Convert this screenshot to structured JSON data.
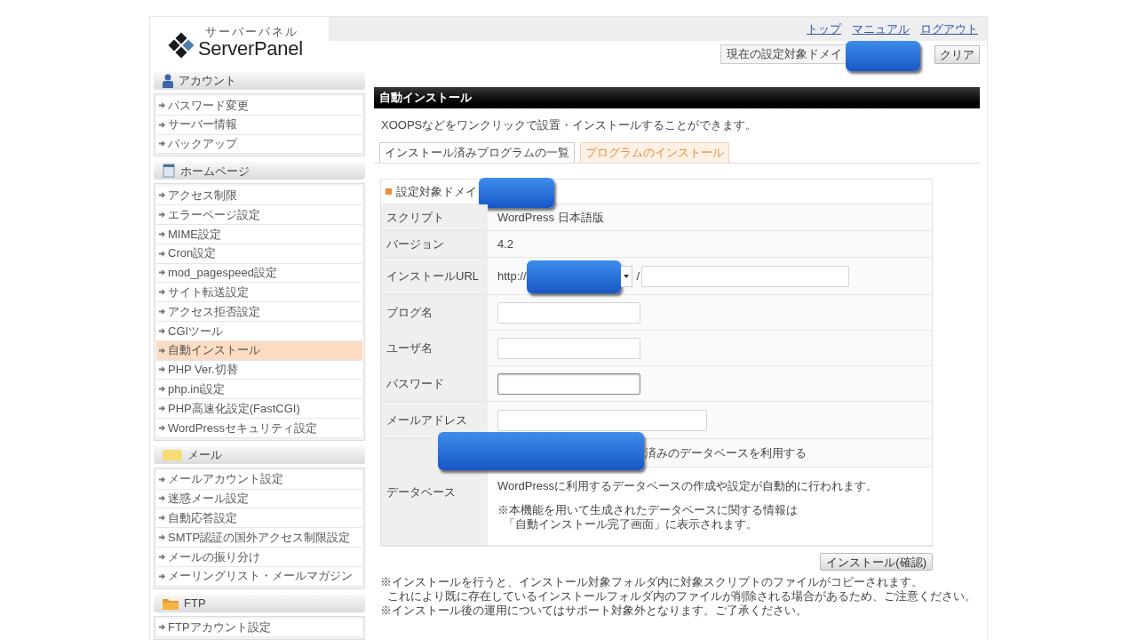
{
  "header": {
    "logo": {
      "kana": "サーバーパネル",
      "name": "ServerPanel"
    },
    "links": [
      "トップ",
      "マニュアル",
      "ログアウト"
    ],
    "domain_label": "現在の設定対象ドメイ",
    "clear_button": "クリア"
  },
  "sidebar": [
    {
      "kind": "account",
      "title": "アカウント",
      "items": [
        {
          "label": "パスワード変更",
          "selected": false
        },
        {
          "label": "サーバー情報",
          "selected": false
        },
        {
          "label": "バックアップ",
          "selected": false
        }
      ]
    },
    {
      "kind": "homepage",
      "title": "ホームページ",
      "items": [
        {
          "label": "アクセス制限",
          "selected": false
        },
        {
          "label": "エラーページ設定",
          "selected": false
        },
        {
          "label": "MIME設定",
          "selected": false
        },
        {
          "label": "Cron設定",
          "selected": false
        },
        {
          "label": "mod_pagespeed設定",
          "selected": false
        },
        {
          "label": "サイト転送設定",
          "selected": false
        },
        {
          "label": "アクセス拒否設定",
          "selected": false
        },
        {
          "label": "CGIツール",
          "selected": false
        },
        {
          "label": "自動インストール",
          "selected": true
        },
        {
          "label": "PHP Ver.切替",
          "selected": false
        },
        {
          "label": "php.ini設定",
          "selected": false
        },
        {
          "label": "PHP高速化設定(FastCGI)",
          "selected": false
        },
        {
          "label": "WordPressセキュリティ設定",
          "selected": false
        }
      ]
    },
    {
      "kind": "mail",
      "title": "メール",
      "items": [
        {
          "label": "メールアカウント設定",
          "selected": false
        },
        {
          "label": "迷惑メール設定",
          "selected": false
        },
        {
          "label": "自動応答設定",
          "selected": false
        },
        {
          "label": "SMTP認証の国外アクセス制限設定",
          "selected": false
        },
        {
          "label": "メールの振り分け",
          "selected": false
        },
        {
          "label": "メーリングリスト・メールマガジン",
          "selected": false
        }
      ]
    },
    {
      "kind": "ftp",
      "title": "FTP",
      "items": [
        {
          "label": "FTPアカウント設定",
          "selected": false
        }
      ]
    }
  ],
  "main": {
    "title": "自動インストール",
    "description": "XOOPSなどをワンクリックで設置・インストールすることができます。",
    "tabs": [
      {
        "label": "インストール済みプログラムの一覧",
        "selected": false
      },
      {
        "label": "プログラムのインストール",
        "selected": true
      }
    ],
    "form": {
      "domain_label": "設定対象ドメイ",
      "rows": [
        {
          "kind": "text",
          "label": "スクリプト",
          "value": "WordPress 日本語版"
        },
        {
          "kind": "text",
          "label": "バージョン",
          "value": "4.2"
        },
        {
          "kind": "url",
          "label": "インストールURL",
          "prefix": "http://",
          "separator": "/"
        },
        {
          "kind": "field",
          "label": "ブログ名",
          "focused": false
        },
        {
          "kind": "field",
          "label": "ユーザ名",
          "focused": false
        },
        {
          "kind": "field",
          "label": "パスワード",
          "focused": true
        },
        {
          "kind": "email",
          "label": "メールアドレス",
          "focused": false
        },
        {
          "kind": "database",
          "label": "データベース",
          "option": "済みのデータベースを利用する",
          "note": "WordPressに利用するデータベースの作成や設定が自動的に行われます。",
          "info": [
            "※本機能を用いて生成されたデータベースに関する情報は",
            "「自動インストール完了画面」に表示されます。"
          ]
        }
      ]
    },
    "submit_button": "インストール(確認)",
    "notes": [
      {
        "lines": [
          "※インストールを行うと、インストール対象フォルダ内に対象スクリプトのファイルがコピーされます。",
          "これにより既に存在しているインストールフォルダ内のファイルが削除される場合があるため、ご注意ください。"
        ]
      },
      {
        "lines": [
          "※インストール後の運用についてはサポート対象外となります。ご了承ください。"
        ]
      }
    ]
  }
}
